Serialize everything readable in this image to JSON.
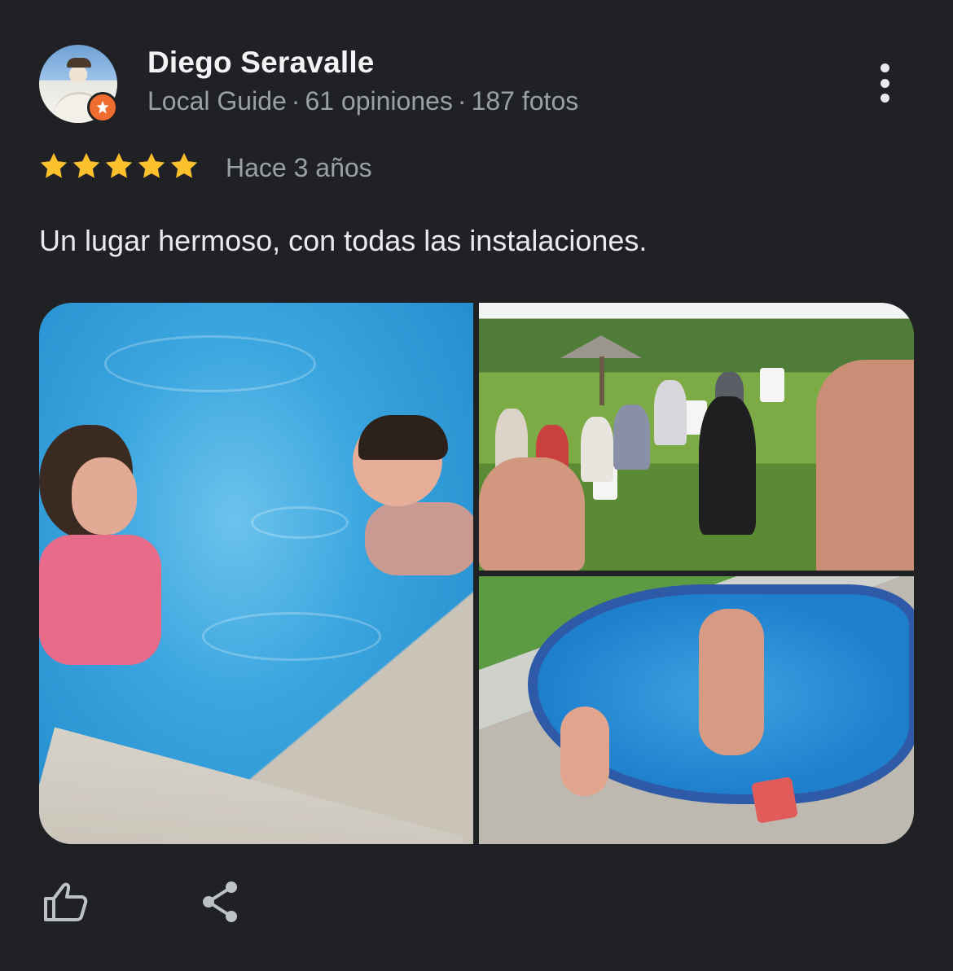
{
  "reviewer": {
    "name": "Diego Seravalle",
    "badge": "Local Guide",
    "separator": "·",
    "reviews": "61 opiniones",
    "photos": "187 fotos"
  },
  "rating": {
    "stars": 5,
    "max": 5,
    "time_ago": "Hace 3 años",
    "star_color": "#fbc02d"
  },
  "review": {
    "text": "Un lugar hermoso, con todas las instalaciones."
  },
  "photo_gallery": {
    "items": [
      "pool-kids-photo",
      "garden-gathering-photo",
      "small-pool-photo"
    ]
  },
  "actions": {
    "like_icon": "thumb-up-icon",
    "share_icon": "share-icon"
  },
  "colors": {
    "background": "#202124",
    "text_primary": "#e8eaed",
    "text_secondary": "#9aa0a6",
    "local_guide_badge": "#ef6c2f"
  }
}
